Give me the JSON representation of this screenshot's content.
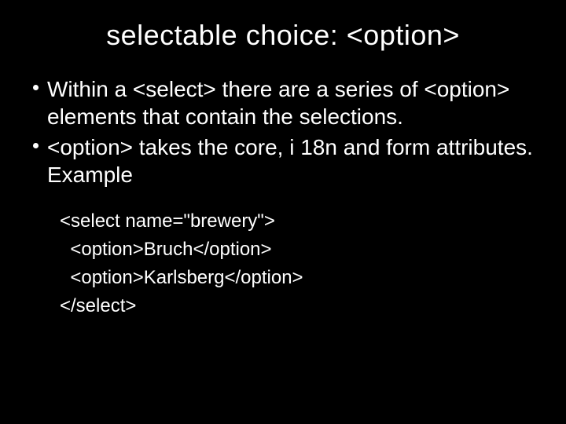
{
  "title": "selectable choice: <option>",
  "bullets": [
    "Within a <select> there are a series of <option> elements that contain the selections.",
    "<option> takes the core, i 18n and form attributes. Example"
  ],
  "code": [
    "<select name=\"brewery\">",
    "  <option>Bruch</option>",
    "  <option>Karlsberg</option>",
    "</select>"
  ]
}
